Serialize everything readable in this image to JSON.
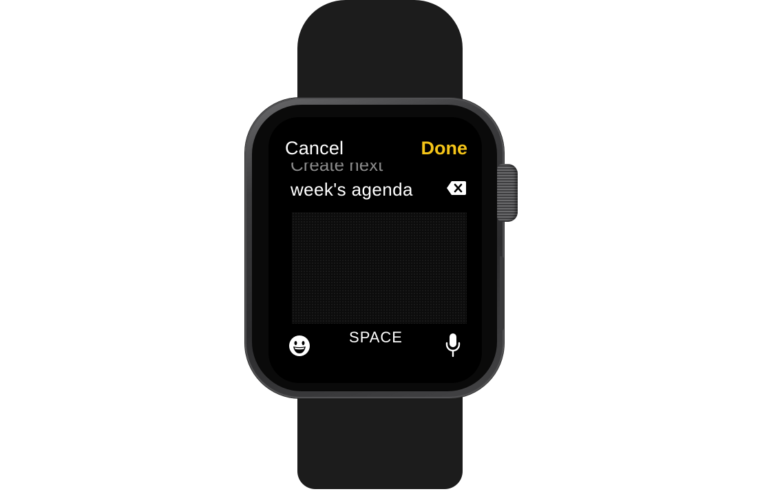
{
  "header": {
    "cancel_label": "Cancel",
    "done_label": "Done"
  },
  "input": {
    "line1": "Create next",
    "line2": "week's agenda"
  },
  "keyboard": {
    "space_label": "SPACE",
    "emoji_icon": "emoji-face-icon",
    "mic_icon": "microphone-icon",
    "delete_icon": "delete-backspace-icon"
  },
  "colors": {
    "accent": "#f5c518",
    "text": "#ffffff",
    "faded_text": "#8a8a8a",
    "background": "#000000"
  }
}
